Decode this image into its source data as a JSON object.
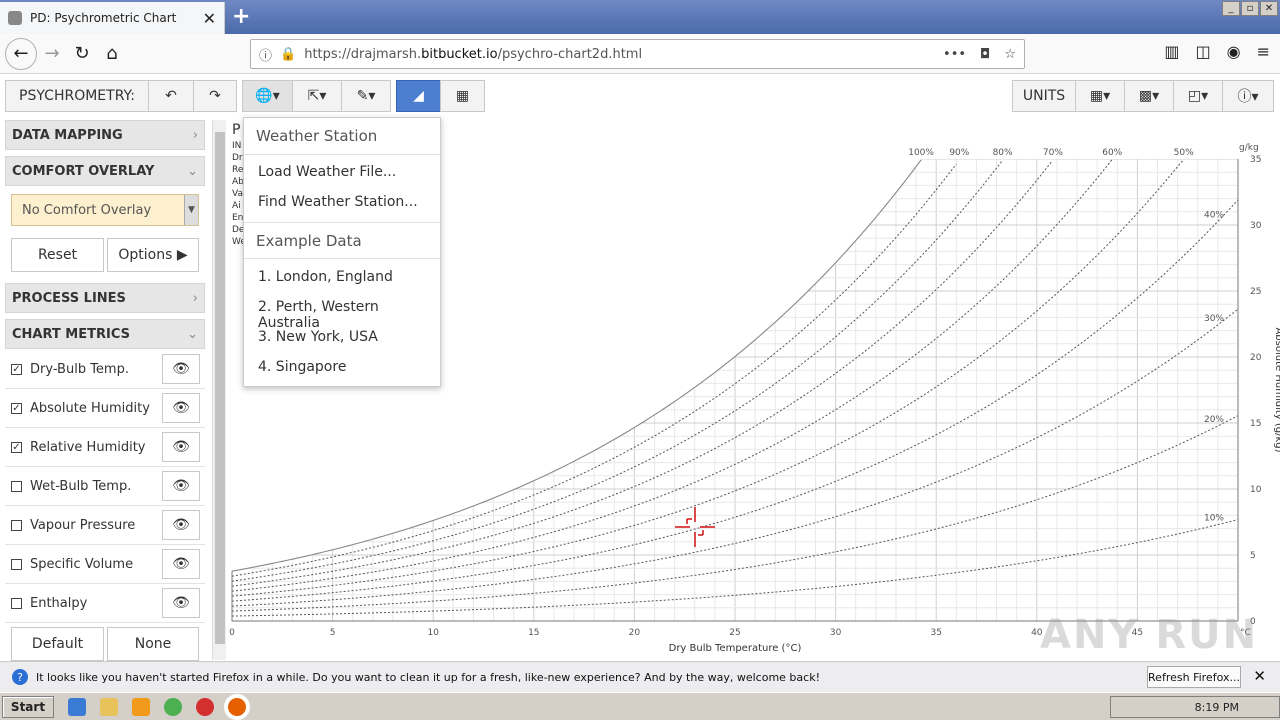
{
  "browser": {
    "tab_title": "PD: Psychrometric Chart",
    "url_prefix": "https://drajmarsh.",
    "url_host": "bitbucket.io",
    "url_path": "/psychro-chart2d.html"
  },
  "toolbar": {
    "app_label": "PSYCHROMETRY:",
    "units_label": "UNITS"
  },
  "sidebar": {
    "data_mapping": "DATA MAPPING",
    "comfort_overlay": "COMFORT OVERLAY",
    "comfort_select": "No Comfort Overlay",
    "reset": "Reset",
    "options": "Options",
    "process_lines": "PROCESS LINES",
    "chart_metrics": "CHART METRICS",
    "metrics": [
      {
        "label": "Dry-Bulb Temp.",
        "checked": true
      },
      {
        "label": "Absolute Humidity",
        "checked": true
      },
      {
        "label": "Relative Humidity",
        "checked": true
      },
      {
        "label": "Wet-Bulb Temp.",
        "checked": false
      },
      {
        "label": "Vapour Pressure",
        "checked": false
      },
      {
        "label": "Specific Volume",
        "checked": false
      },
      {
        "label": "Enthalpy",
        "checked": false
      }
    ],
    "default_btn": "Default",
    "none_btn": "None"
  },
  "menu": {
    "weather_header": "Weather Station",
    "load": "Load Weather File...",
    "find": "Find Weather Station...",
    "example_header": "Example Data",
    "examples": [
      "1. London, England",
      "2. Perth, Western Australia",
      "3. New York, USA",
      "4. Singapore"
    ]
  },
  "chart_data": {
    "type": "line",
    "xlabel": "Dry Bulb Temperature (°C)",
    "ylabel": "Absolute Humidity (g/kg)",
    "x_unit": "°C",
    "y_unit": "g/kg",
    "xlim": [
      0,
      50
    ],
    "ylim": [
      0,
      35
    ],
    "x_ticks": [
      0,
      5,
      10,
      15,
      20,
      25,
      30,
      35,
      40,
      45
    ],
    "y_ticks": [
      0,
      5,
      10,
      15,
      20,
      25,
      30,
      35
    ],
    "rh_top_labels": [
      "100%",
      "90%",
      "80%",
      "70%",
      "60%",
      "50%"
    ],
    "rh_side_labels": [
      "40%",
      "30%",
      "20%",
      "10%"
    ],
    "rh_curves": [
      100,
      90,
      80,
      70,
      60,
      50,
      40,
      30,
      20,
      10
    ],
    "side_text": [
      "P",
      "IN",
      "Dr",
      "Re",
      "Ab",
      "Va",
      "Ai",
      "En",
      "De",
      "We"
    ],
    "grid": true
  },
  "notification": {
    "text": "It looks like you haven't started Firefox in a while. Do you want to clean it up for a fresh, like-new experience? And by the way, welcome back!",
    "button": "Refresh Firefox..."
  },
  "taskbar": {
    "start": "Start",
    "clock": "8:19 PM"
  },
  "watermark": "ANY RUN"
}
